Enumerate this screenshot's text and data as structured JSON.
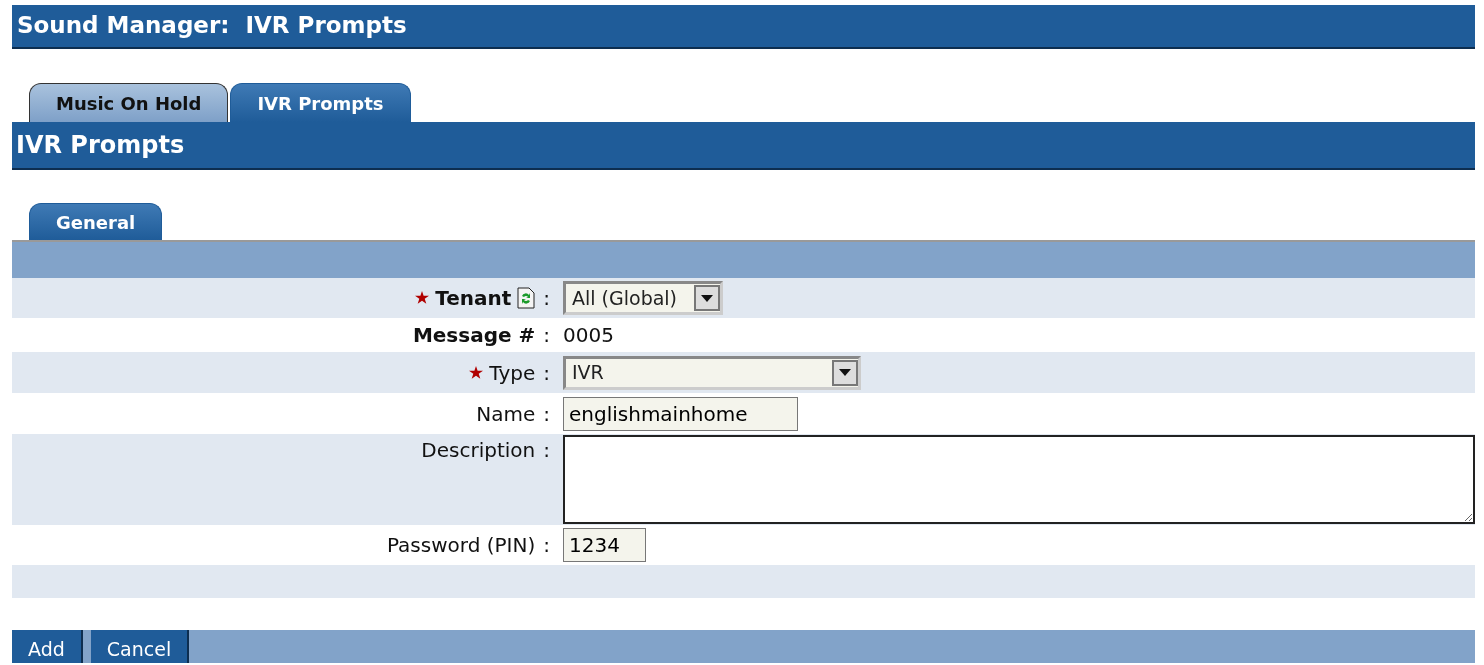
{
  "page_title": "Sound Manager:  IVR Prompts",
  "tabs": [
    {
      "label": "Music On Hold",
      "selected": false
    },
    {
      "label": "IVR Prompts",
      "selected": true
    }
  ],
  "section_title": "IVR Prompts",
  "subtabs": [
    {
      "label": "General",
      "selected": true
    }
  ],
  "fields": [
    {
      "label": "Tenant",
      "separator": ":",
      "required": true,
      "bold": true,
      "refresh": true,
      "kind": "select",
      "value": "All (Global)"
    },
    {
      "label": "Message #",
      "separator": ":",
      "required": false,
      "bold": true,
      "refresh": false,
      "kind": "static",
      "value": "0005"
    },
    {
      "label": "Type",
      "separator": ":",
      "required": true,
      "bold": false,
      "refresh": false,
      "kind": "select",
      "value": "IVR"
    },
    {
      "label": "Name",
      "separator": ":",
      "required": false,
      "bold": false,
      "refresh": false,
      "kind": "text",
      "value": "englishmainhome"
    },
    {
      "label": "Description",
      "separator": ":",
      "required": false,
      "bold": false,
      "refresh": false,
      "kind": "textarea"
    },
    {
      "label": "Password (PIN)",
      "separator": ":",
      "required": false,
      "bold": false,
      "refresh": false,
      "kind": "text",
      "value": "1234"
    }
  ],
  "buttons": [
    "Add",
    "Cancel"
  ]
}
